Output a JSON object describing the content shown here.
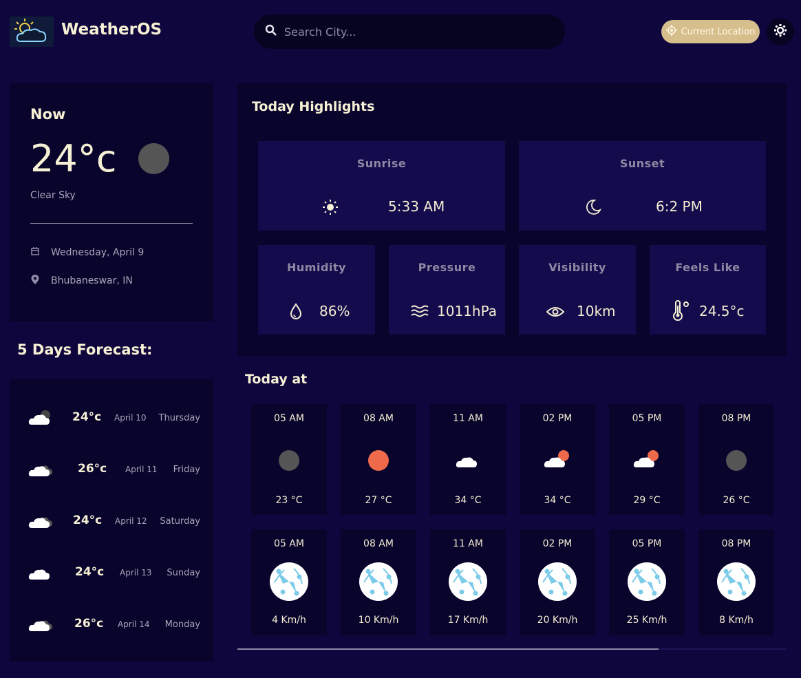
{
  "header": {
    "app_title": "WeatherOS",
    "search_placeholder": "Search City...",
    "location_button": "Current Location"
  },
  "now": {
    "label": "Now",
    "temp": "24°c",
    "description": "Clear Sky",
    "date": "Wednesday, April 9",
    "location": "Bhubaneswar, IN"
  },
  "forecast": {
    "title": "5 Days Forecast:",
    "days": [
      {
        "temp": "24°c",
        "date": "April 10",
        "day": "Thursday",
        "icon": "cloudy-icon"
      },
      {
        "temp": "26°c",
        "date": "April 11",
        "day": "Friday",
        "icon": "cloudy-icon"
      },
      {
        "temp": "24°c",
        "date": "April 12",
        "day": "Saturday",
        "icon": "cloudy-icon"
      },
      {
        "temp": "24°c",
        "date": "April 13",
        "day": "Sunday",
        "icon": "cloud-icon"
      },
      {
        "temp": "26°c",
        "date": "April 14",
        "day": "Monday",
        "icon": "cloudy-icon"
      }
    ]
  },
  "highlights": {
    "title": "Today Highlights",
    "sunrise": {
      "label": "Sunrise",
      "value": "5:33 AM"
    },
    "sunset": {
      "label": "Sunset",
      "value": "6:2 PM"
    },
    "humidity": {
      "label": "Humidity",
      "value": "86%"
    },
    "pressure": {
      "label": "Pressure",
      "value": "1011hPa"
    },
    "visibility": {
      "label": "Visibility",
      "value": "10km"
    },
    "feels_like": {
      "label": "Feels Like",
      "value": "24.5°c"
    }
  },
  "today_at": {
    "title": "Today at",
    "temps": [
      {
        "time": "05 AM",
        "value": "23 °C",
        "icon": "dark-moon-icon"
      },
      {
        "time": "08 AM",
        "value": "27 °C",
        "icon": "sun-icon"
      },
      {
        "time": "11 AM",
        "value": "34 °C",
        "icon": "cloud-icon"
      },
      {
        "time": "02 PM",
        "value": "34 °C",
        "icon": "cloud-sun-icon"
      },
      {
        "time": "05 PM",
        "value": "29 °C",
        "icon": "cloud-sun-icon"
      },
      {
        "time": "08 PM",
        "value": "26 °C",
        "icon": "dark-moon-icon"
      }
    ],
    "winds": [
      {
        "time": "05 AM",
        "value": "4 Km/h"
      },
      {
        "time": "08 AM",
        "value": "10 Km/h"
      },
      {
        "time": "11 AM",
        "value": "17 Km/h"
      },
      {
        "time": "02 PM",
        "value": "20 Km/h"
      },
      {
        "time": "05 PM",
        "value": "25 Km/h"
      },
      {
        "time": "08 PM",
        "value": "8 Km/h"
      }
    ]
  },
  "colors": {
    "background": "#0f063d",
    "card": "#09042c",
    "highlight_box": "#140b4c",
    "accent": "#d7bf8d",
    "sun": "#ee6a4a"
  }
}
